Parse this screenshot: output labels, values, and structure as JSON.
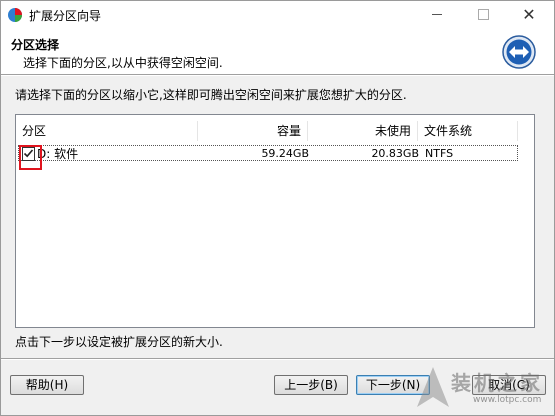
{
  "window": {
    "title": "扩展分区向导"
  },
  "header": {
    "title": "分区选择",
    "subtitle": "选择下面的分区,以从中获得空闲空间."
  },
  "instruction": "请选择下面的分区以缩小它,这样即可腾出空闲空间来扩展您想扩大的分区.",
  "table": {
    "columns": [
      "分区",
      "容量",
      "未使用",
      "文件系统"
    ],
    "rows": [
      {
        "checked": true,
        "partition": "D: 软件",
        "capacity": "59.24GB",
        "unused": "20.83GB",
        "filesystem": "NTFS"
      }
    ]
  },
  "footer_note": "点击下一步以设定被扩展分区的新大小.",
  "buttons": {
    "help": "帮助(H)",
    "prev": "上一步(B)",
    "next": "下一步(N)",
    "cancel": "取消(C)"
  },
  "watermark": {
    "text": "装机之家",
    "url": "www.lotpc.com"
  },
  "colors": {
    "highlight_box": "#e0141e",
    "accent": "#1e5fb4"
  }
}
